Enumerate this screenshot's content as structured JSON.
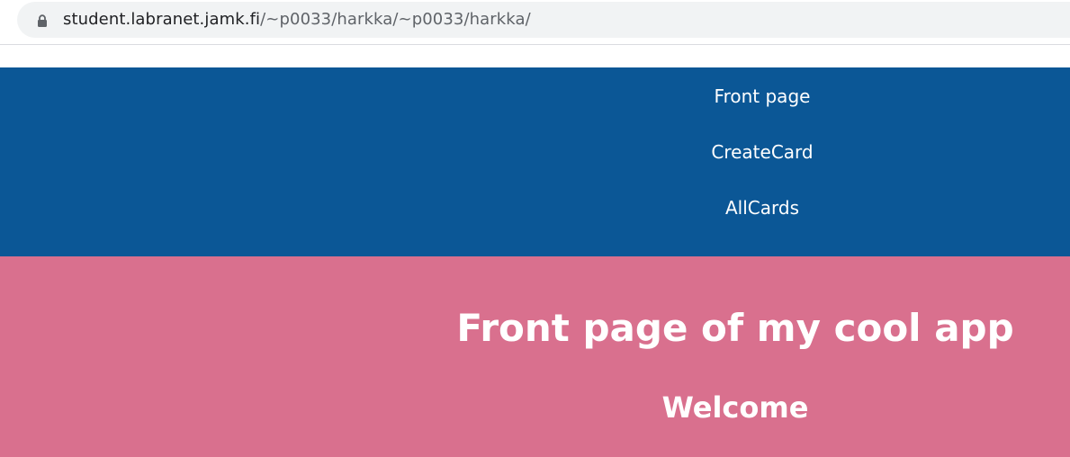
{
  "browser": {
    "url_host": "student.labranet.jamk.fi",
    "url_path": "/~p0033/harkka/~p0033/harkka/",
    "lock_icon": "lock-icon"
  },
  "nav": {
    "background": "#0b5796",
    "links": [
      {
        "label": "Front page"
      },
      {
        "label": "CreateCard"
      },
      {
        "label": "AllCards"
      }
    ]
  },
  "main": {
    "background": "#d9708e",
    "title": "Front page of my cool app",
    "subtitle": "Welcome"
  }
}
